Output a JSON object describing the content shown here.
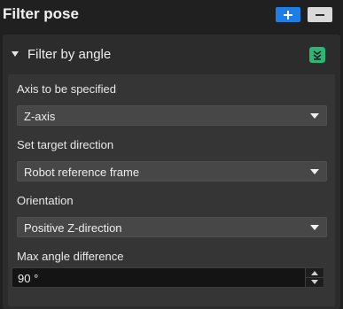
{
  "header": {
    "title": "Filter pose",
    "add_icon": "plus-icon",
    "remove_icon": "minus-icon",
    "add_color": "#1f7ee6",
    "remove_color": "#d9d9d9"
  },
  "section": {
    "title": "Filter by angle",
    "expanded": true,
    "collapse_icon": "collapse-icon",
    "collapse_color": "#2bb673"
  },
  "fields": {
    "axis": {
      "label": "Axis to be specified",
      "value": "Z-axis"
    },
    "target_direction": {
      "label": "Set target direction",
      "value": "Robot reference frame"
    },
    "orientation": {
      "label": "Orientation",
      "value": "Positive Z-direction"
    },
    "max_angle": {
      "label": "Max angle difference",
      "value": "90 °"
    }
  }
}
